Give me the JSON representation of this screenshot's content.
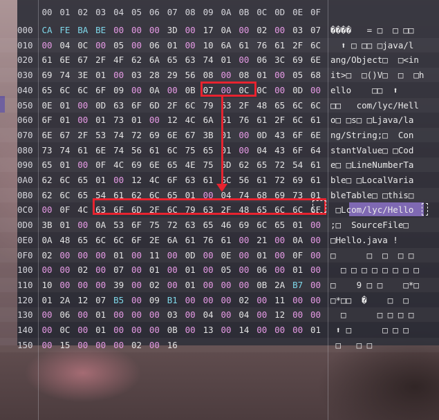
{
  "header": {
    "columns": [
      "00",
      "01",
      "02",
      "03",
      "04",
      "05",
      "06",
      "07",
      "08",
      "09",
      "0A",
      "0B",
      "0C",
      "0D",
      "0E",
      "0F"
    ]
  },
  "colors": {
    "default": "#e4e4e4",
    "zero": "#e79be6",
    "highlight": "#7fd8ea",
    "address": "#d6d6dc",
    "annotation": "#e8232f",
    "selection": "#7f69b3"
  },
  "rows": [
    {
      "addr": "000",
      "bytes": [
        "CA",
        "FE",
        "BA",
        "BE",
        "00",
        "00",
        "00",
        "3D",
        "00",
        "17",
        "0A",
        "00",
        "02",
        "00",
        "03",
        "07"
      ],
      "ascii": "����   = □  □ □□"
    },
    {
      "addr": "010",
      "bytes": [
        "00",
        "04",
        "0C",
        "00",
        "05",
        "00",
        "06",
        "01",
        "00",
        "10",
        "6A",
        "61",
        "76",
        "61",
        "2F",
        "6C"
      ],
      "ascii": "  ⬆ □ □□ □java/l"
    },
    {
      "addr": "020",
      "bytes": [
        "61",
        "6E",
        "67",
        "2F",
        "4F",
        "62",
        "6A",
        "65",
        "63",
        "74",
        "01",
        "00",
        "06",
        "3C",
        "69",
        "6E"
      ],
      "ascii": "ang/Object□  □<in"
    },
    {
      "addr": "030",
      "bytes": [
        "69",
        "74",
        "3E",
        "01",
        "00",
        "03",
        "28",
        "29",
        "56",
        "08",
        "00",
        "08",
        "01",
        "00",
        "05",
        "68"
      ],
      "ascii": "it>□  □()V□  □  □h"
    },
    {
      "addr": "040",
      "bytes": [
        "65",
        "6C",
        "6C",
        "6F",
        "09",
        "00",
        "0A",
        "00",
        "0B",
        "07",
        "00",
        "0C",
        "0C",
        "00",
        "0D",
        "00"
      ],
      "ascii": "ello    □□  ⬆"
    },
    {
      "addr": "050",
      "bytes": [
        "0E",
        "01",
        "00",
        "0D",
        "63",
        "6F",
        "6D",
        "2F",
        "6C",
        "79",
        "63",
        "2F",
        "48",
        "65",
        "6C",
        "6C"
      ],
      "ascii": "□□   com/lyc/Hell"
    },
    {
      "addr": "060",
      "bytes": [
        "6F",
        "01",
        "00",
        "01",
        "73",
        "01",
        "00",
        "12",
        "4C",
        "6A",
        "61",
        "76",
        "61",
        "2F",
        "6C",
        "61"
      ],
      "ascii": "o□ □s□ □Ljava/la"
    },
    {
      "addr": "070",
      "bytes": [
        "6E",
        "67",
        "2F",
        "53",
        "74",
        "72",
        "69",
        "6E",
        "67",
        "3B",
        "01",
        "00",
        "0D",
        "43",
        "6F",
        "6E"
      ],
      "ascii": "ng/String;□  Con"
    },
    {
      "addr": "080",
      "bytes": [
        "73",
        "74",
        "61",
        "6E",
        "74",
        "56",
        "61",
        "6C",
        "75",
        "65",
        "01",
        "00",
        "04",
        "43",
        "6F",
        "64"
      ],
      "ascii": "stantValue□ □Cod"
    },
    {
      "addr": "090",
      "bytes": [
        "65",
        "01",
        "00",
        "0F",
        "4C",
        "69",
        "6E",
        "65",
        "4E",
        "75",
        "6D",
        "62",
        "65",
        "72",
        "54",
        "61"
      ],
      "ascii": "e□ □LineNumberTa"
    },
    {
      "addr": "0A0",
      "bytes": [
        "62",
        "6C",
        "65",
        "01",
        "00",
        "12",
        "4C",
        "6F",
        "63",
        "61",
        "6C",
        "56",
        "61",
        "72",
        "69",
        "61"
      ],
      "ascii": "ble□ □LocalVaria"
    },
    {
      "addr": "0B0",
      "bytes": [
        "62",
        "6C",
        "65",
        "54",
        "61",
        "62",
        "6C",
        "65",
        "01",
        "00",
        "04",
        "74",
        "68",
        "69",
        "73",
        "01"
      ],
      "ascii": "bleTable□ □this□"
    },
    {
      "addr": "0C0",
      "bytes": [
        "00",
        "0F",
        "4C",
        "63",
        "6F",
        "6D",
        "2F",
        "6C",
        "79",
        "63",
        "2F",
        "48",
        "65",
        "6C",
        "6C",
        "6F"
      ],
      "ascii": " □Lcom/lyc/Hello"
    },
    {
      "addr": "0D0",
      "bytes": [
        "3B",
        "01",
        "00",
        "0A",
        "53",
        "6F",
        "75",
        "72",
        "63",
        "65",
        "46",
        "69",
        "6C",
        "65",
        "01",
        "00"
      ],
      "ascii": ";□  SourceFile□"
    },
    {
      "addr": "0E0",
      "bytes": [
        "0A",
        "48",
        "65",
        "6C",
        "6C",
        "6F",
        "2E",
        "6A",
        "61",
        "76",
        "61",
        "00",
        "21",
        "00",
        "0A",
        "00"
      ],
      "ascii": "□Hello.java !"
    },
    {
      "addr": "0F0",
      "bytes": [
        "02",
        "00",
        "00",
        "00",
        "01",
        "00",
        "11",
        "00",
        "0D",
        "00",
        "0E",
        "00",
        "01",
        "00",
        "0F",
        "00"
      ],
      "ascii": "□      □  □  □ □"
    },
    {
      "addr": "100",
      "bytes": [
        "00",
        "00",
        "02",
        "00",
        "07",
        "00",
        "01",
        "00",
        "01",
        "00",
        "05",
        "00",
        "06",
        "00",
        "01",
        "00"
      ],
      "ascii": "  □ □ □ □ □ □ □ □"
    },
    {
      "addr": "110",
      "bytes": [
        "10",
        "00",
        "00",
        "00",
        "39",
        "00",
        "02",
        "00",
        "01",
        "00",
        "00",
        "00",
        "0B",
        "2A",
        "B7",
        "00"
      ],
      "ascii": "□    9 □ □    □*□"
    },
    {
      "addr": "120",
      "bytes": [
        "01",
        "2A",
        "12",
        "07",
        "B5",
        "00",
        "09",
        "B1",
        "00",
        "00",
        "00",
        "02",
        "00",
        "11",
        "00",
        "00"
      ],
      "ascii": "□*□□  �    □  □"
    },
    {
      "addr": "130",
      "bytes": [
        "00",
        "06",
        "00",
        "01",
        "00",
        "00",
        "00",
        "03",
        "00",
        "04",
        "00",
        "04",
        "00",
        "12",
        "00",
        "00"
      ],
      "ascii": "  □      □ □ □ □"
    },
    {
      "addr": "140",
      "bytes": [
        "00",
        "0C",
        "00",
        "01",
        "00",
        "00",
        "00",
        "0B",
        "00",
        "13",
        "00",
        "14",
        "00",
        "00",
        "00",
        "01"
      ],
      "ascii": " ⬆ □      □ □ □"
    },
    {
      "addr": "150",
      "bytes": [
        "00",
        "15",
        "00",
        "00",
        "00",
        "02",
        "00",
        "16"
      ],
      "ascii": " □   □ □"
    }
  ],
  "annotation": {
    "source_bytes": "07 00 0C",
    "target_bytes": "63 6F 6D 2F 6C 79 63 2F 48 65 6C 6C 6F",
    "target_ascii": "com/lyc/Hello"
  }
}
